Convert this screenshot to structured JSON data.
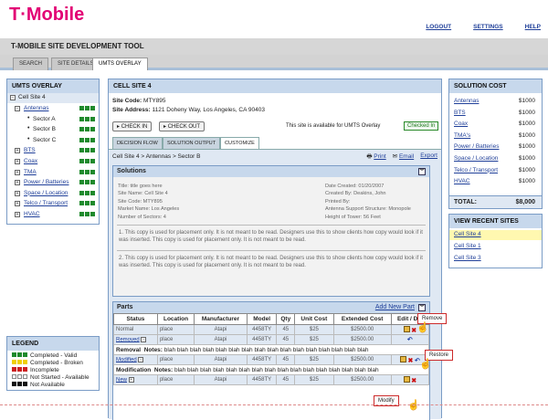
{
  "header": {
    "brand": "T·Mobile",
    "links": [
      "LOGOUT",
      "SETTINGS",
      "HELP"
    ],
    "app_title": "T-MOBILE SITE DEVELOPMENT TOOL",
    "tabs": [
      "SEARCH",
      "SITE DETAILS",
      "UMTS OVERLAY"
    ]
  },
  "tree": {
    "title": "UMTS OVERLAY",
    "root": "Cell Site 4",
    "items": [
      {
        "label": "Antennas",
        "expander": "−",
        "level": 1,
        "dots": [
          "g",
          "g",
          "g"
        ]
      },
      {
        "label": "Sector A",
        "level": 2,
        "dots": [
          "g",
          "g",
          "g"
        ]
      },
      {
        "label": "Sector B",
        "level": 2,
        "dots": [
          "g",
          "g",
          "g"
        ]
      },
      {
        "label": "Sector C",
        "level": 2,
        "dots": [
          "g",
          "g",
          "g"
        ]
      },
      {
        "label": "BTS",
        "expander": "+",
        "level": 1,
        "dots": [
          "g",
          "g",
          "g"
        ]
      },
      {
        "label": "Coax",
        "expander": "+",
        "level": 1,
        "dots": [
          "g",
          "g",
          "g"
        ]
      },
      {
        "label": "TMA",
        "expander": "+",
        "level": 1,
        "dots": [
          "g",
          "g",
          "g"
        ]
      },
      {
        "label": "Power / Batteries",
        "expander": "+",
        "level": 1,
        "dots": [
          "g",
          "g",
          "g"
        ]
      },
      {
        "label": "Space / Location",
        "expander": "+",
        "level": 1,
        "dots": [
          "g",
          "g",
          "g"
        ]
      },
      {
        "label": "Telco / Transport",
        "expander": "+",
        "level": 1,
        "dots": [
          "g",
          "g",
          "g"
        ]
      },
      {
        "label": "HVAC",
        "expander": "+",
        "level": 1,
        "dots": [
          "g",
          "g",
          "g"
        ]
      }
    ]
  },
  "legend": {
    "title": "LEGEND",
    "items": [
      {
        "label": "Completed - Valid",
        "dots": [
          "g",
          "g",
          "g"
        ]
      },
      {
        "label": "Completed - Broken",
        "dots": [
          "y",
          "y",
          "y"
        ]
      },
      {
        "label": "Incomplete",
        "dots": [
          "r",
          "r",
          "r"
        ]
      },
      {
        "label": "Not Started - Available",
        "dots": [
          "w",
          "w",
          "w"
        ]
      },
      {
        "label": "Not Available",
        "dots": [
          "k",
          "k",
          "k"
        ]
      }
    ]
  },
  "center": {
    "title": "CELL SITE 4",
    "site_code_label": "Site Code:",
    "site_code": "MTY895",
    "site_address_label": "Site Address:",
    "site_address": "1121 Doheny Way, Los Angeles, CA 90403",
    "check_in": "CHECK IN",
    "check_out": "CHECK OUT",
    "availability": "This site is available for UMTS Overlay",
    "checked_in": "Checked In",
    "tabs": [
      "DECISION FLOW",
      "SOLUTION OUTPUT",
      "CUSTOMIZE"
    ],
    "breadcrumb": "Cell Site 4 > Antennas > Sector B",
    "actions": [
      "Print",
      "Email",
      "Export"
    ],
    "solutions": {
      "title": "Solutions",
      "left": [
        "Title: title goes here",
        "Site Name: Cell Site 4",
        "Site Code: MTY895",
        "Market Name: Los Angeles",
        "Number of Sectors: 4"
      ],
      "right": [
        "Date Created: 01/20/2007",
        "Created By: Deakins, John",
        "Printed By:",
        "Antenna Support Structure: Monopole",
        "Height of Tower: 56 Feet"
      ],
      "para1": "1. This copy is used for placement only. It is not meant to be read. Designers use this to show clients how copy would look if it was inserted. This copy is used for placement only. It is not meant to be read.",
      "para2": "2. This copy is used for placement only. It is not meant to be read. Designers use this to show clients how copy would look if it was inserted. This copy is used for placement only. It is not meant to be read."
    },
    "parts": {
      "title": "Parts",
      "add_new": "Add New Part",
      "headers": [
        "Status",
        "Location",
        "Manufacturer",
        "Model",
        "Qty",
        "Unit Cost",
        "Extended Cost",
        "Edit / Del"
      ],
      "rows": [
        {
          "status": "Normal",
          "location": "place",
          "manufacturer": "Atapi",
          "model": "4458TY",
          "qty": "45",
          "unit": "$25",
          "ext": "$2500.00"
        },
        {
          "status": "Removed",
          "location": "place",
          "manufacturer": "Atapi",
          "model": "4458TY",
          "qty": "45",
          "unit": "$25",
          "ext": "$2500.00"
        },
        {
          "status": "Modified",
          "location": "place",
          "manufacturer": "Atapi",
          "model": "4458TY",
          "qty": "45",
          "unit": "$25",
          "ext": "$2500.00"
        },
        {
          "status": "New",
          "location": "place",
          "manufacturer": "Atapi",
          "model": "4458TY",
          "qty": "45",
          "unit": "$25",
          "ext": "$2500.00"
        }
      ],
      "removal_label": "Removal",
      "modification_label": "Modification",
      "notes_label": "Notes:",
      "notes_text": "blah blah blah blah blah blah blah blah blah blah blah blah blah blah blah blah",
      "callouts": [
        "Remove",
        "Restore",
        "Modify"
      ]
    }
  },
  "cost": {
    "title": "SOLUTION COST",
    "items": [
      {
        "label": "Antennas",
        "value": "$1000"
      },
      {
        "label": "BTS",
        "value": "$1000"
      },
      {
        "label": "Coax",
        "value": "$1000"
      },
      {
        "label": "TMA's",
        "value": "$1000"
      },
      {
        "label": "Power / Batteries",
        "value": "$1000"
      },
      {
        "label": "Space / Location",
        "value": "$1000"
      },
      {
        "label": "Telco / Transport",
        "value": "$1000"
      },
      {
        "label": "HVAC",
        "value": "$1000"
      }
    ],
    "total_label": "TOTAL:",
    "total_value": "$8,000"
  },
  "recent": {
    "title": "VIEW RECENT SITES",
    "items": [
      "Cell Site 4",
      "Cell Site 1",
      "Cell Site 3"
    ]
  },
  "colors": {
    "brand": "#e20074",
    "panel_head": "#c7d8ec",
    "link": "#1f3f99",
    "valid": "#1f8a2c"
  }
}
